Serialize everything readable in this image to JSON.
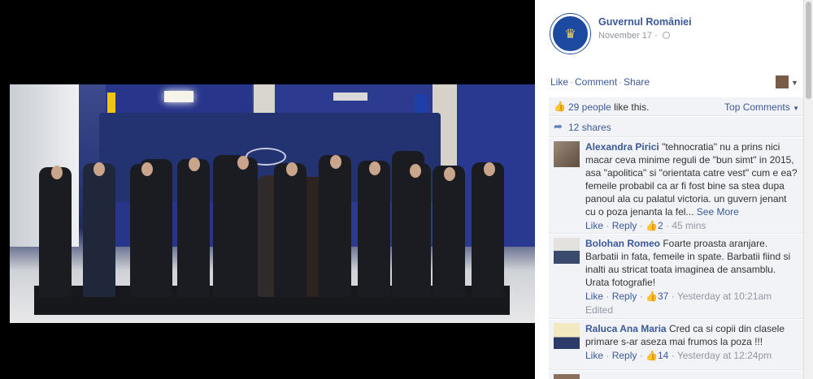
{
  "post": {
    "page_name": "Guvernul României",
    "date": "November 17",
    "seal_text": "GUVERNUL ROMÂNIEI"
  },
  "actions": {
    "like": "Like",
    "comment": "Comment",
    "share": "Share"
  },
  "likes": {
    "count_text": "29 people",
    "suffix": "like this.",
    "top_comments": "Top Comments"
  },
  "shares": {
    "text": "12 shares"
  },
  "comments": [
    {
      "author": "Alexandra Pirici",
      "text": "\"tehnocratia\" nu a prins nici macar ceva minime reguli de \"bun simt\" in 2015, asa \"apolitica\" si \"orientata catre vest\" cum e ea? femeile probabil ca ar fi fost bine sa stea dupa panoul ala cu palatul victoria. un guvern jenant cu o poza jenanta la fel...",
      "see_more": "See More",
      "like": "Like",
      "reply": "Reply",
      "likes": "2",
      "time": "45 mins",
      "edited": ""
    },
    {
      "author": "Bolohan Romeo",
      "text": "Foarte proasta aranjare. Barbatii in fata, femeile in spate. Barbatii fiind si inalti au stricat toata imaginea de ansamblu. Urata fotografie!",
      "see_more": "",
      "like": "Like",
      "reply": "Reply",
      "likes": "37",
      "time": "Yesterday at 10:21am",
      "edited": "Edited"
    },
    {
      "author": "Raluca Ana Maria",
      "text": "Cred ca si copii din clasele primare s-ar aseza mai frumos la poza !!!",
      "see_more": "",
      "like": "Like",
      "reply": "Reply",
      "likes": "14",
      "time": "Yesterday at 12:24pm",
      "edited": ""
    }
  ],
  "icons": [
    "globe-icon",
    "thumbs-up-icon",
    "share-arrow-icon",
    "chevron-down-icon"
  ],
  "colors": {
    "link": "#3b5998",
    "meta": "#9197a3",
    "panel_bg": "#f2f3f6"
  }
}
